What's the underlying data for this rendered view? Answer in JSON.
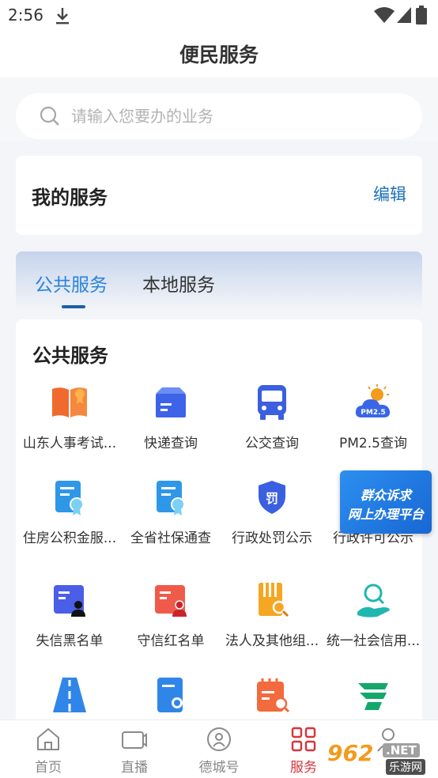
{
  "status_bar": {
    "time": "2:56"
  },
  "header": {
    "title": "便民服务"
  },
  "search": {
    "placeholder": "请输入您要办的业务"
  },
  "my_services": {
    "title": "我的服务",
    "edit_label": "编辑"
  },
  "tabs": [
    {
      "label": "公共服务",
      "active": true
    },
    {
      "label": "本地服务",
      "active": false
    }
  ],
  "public_services": {
    "title": "公共服务",
    "items": [
      {
        "label": "山东人事考试...",
        "icon": "open-book-icon"
      },
      {
        "label": "快递查询",
        "icon": "parcel-box-icon"
      },
      {
        "label": "公交查询",
        "icon": "bus-icon"
      },
      {
        "label": "PM2.5查询",
        "icon": "pm25-cloud-icon"
      },
      {
        "label": "住房公积金服...",
        "icon": "certificate-icon"
      },
      {
        "label": "全省社保通查",
        "icon": "certificate-icon"
      },
      {
        "label": "行政处罚公示",
        "icon": "penalty-shield-icon"
      },
      {
        "label": "行政许可公示",
        "icon": "permit-icon"
      },
      {
        "label": "失信黑名单",
        "icon": "blacklist-card-icon"
      },
      {
        "label": "守信红名单",
        "icon": "redlist-card-icon"
      },
      {
        "label": "法人及其他组...",
        "icon": "document-search-icon"
      },
      {
        "label": "统一社会信用...",
        "icon": "person-search-hand-icon"
      },
      {
        "label": "",
        "icon": "highway-icon"
      },
      {
        "label": "",
        "icon": "badge-document-icon"
      },
      {
        "label": "",
        "icon": "calendar-search-icon"
      },
      {
        "label": "",
        "icon": "postal-icon"
      }
    ]
  },
  "float_banner": {
    "line1": "群众诉求",
    "line2": "网上办理平台"
  },
  "bottom_nav": [
    {
      "label": "首页",
      "icon": "home-icon",
      "active": false
    },
    {
      "label": "直播",
      "icon": "video-camera-icon",
      "active": false
    },
    {
      "label": "德城号",
      "icon": "channel-icon",
      "active": false
    },
    {
      "label": "服务",
      "icon": "grid-icon",
      "active": true
    },
    {
      "label": "",
      "icon": "profile-icon",
      "active": false
    }
  ],
  "watermark": {
    "number": "962",
    "tld": ".NET",
    "site": "乐游网"
  },
  "colors": {
    "accent_blue": "#2a83dc",
    "active_nav_red": "#d7343a",
    "edit_blue": "#1d6fb8"
  }
}
